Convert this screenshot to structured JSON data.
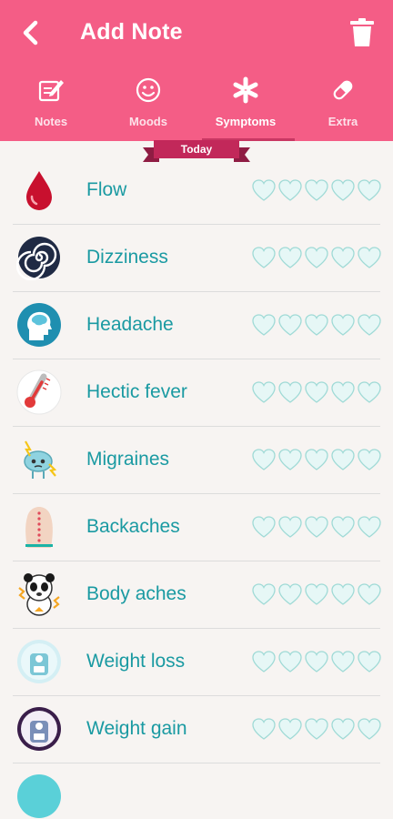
{
  "header": {
    "title": "Add Note",
    "back_icon": "chevron-left-icon",
    "delete_icon": "trash-icon"
  },
  "tabs": [
    {
      "label": "Notes",
      "icon": "note-edit-icon"
    },
    {
      "label": "Moods",
      "icon": "smiley-icon"
    },
    {
      "label": "Symptoms",
      "icon": "asterisk-icon",
      "active": true
    },
    {
      "label": "Extra",
      "icon": "pill-icon"
    }
  ],
  "date_ribbon": "Today",
  "symptoms": [
    {
      "name": "Flow",
      "icon": "blood-drop-icon",
      "rating": 0
    },
    {
      "name": "Dizziness",
      "icon": "spiral-icon",
      "rating": 0
    },
    {
      "name": "Headache",
      "icon": "brain-head-icon",
      "rating": 0
    },
    {
      "name": "Hectic fever",
      "icon": "thermometer-icon",
      "rating": 0
    },
    {
      "name": "Migraines",
      "icon": "brain-lightning-icon",
      "rating": 0
    },
    {
      "name": "Backaches",
      "icon": "spine-back-icon",
      "rating": 0
    },
    {
      "name": "Body aches",
      "icon": "panda-pain-icon",
      "rating": 0
    },
    {
      "name": "Weight loss",
      "icon": "scale-loss-icon",
      "rating": 0
    },
    {
      "name": "Weight gain",
      "icon": "scale-gain-icon",
      "rating": 0
    }
  ],
  "rating_max": 5,
  "colors": {
    "header": "#f45d86",
    "ribbon": "#c2285a",
    "symptom_text": "#1a9aa2",
    "heart_fill": "#e6f7f6",
    "heart_stroke": "#9fdad6"
  }
}
